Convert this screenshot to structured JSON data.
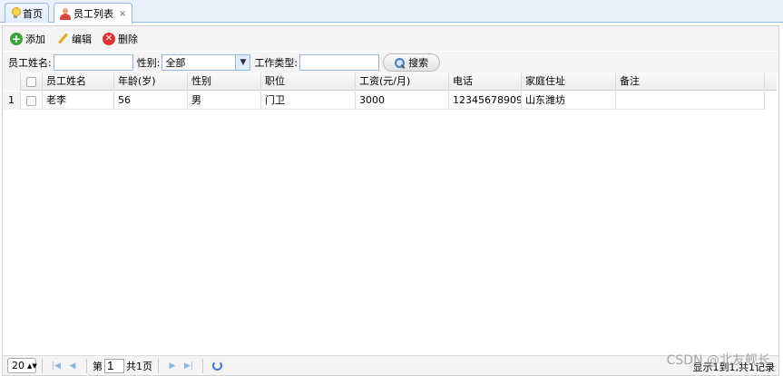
{
  "tabs": [
    {
      "label": "首页",
      "icon": "bulb-icon"
    },
    {
      "label": "员工列表",
      "icon": "user-icon",
      "close": "×"
    }
  ],
  "toolbar": {
    "add": "添加",
    "edit": "编辑",
    "delete": "删除"
  },
  "search": {
    "name_label": "员工姓名:",
    "name_value": "",
    "gender_label": "性别:",
    "gender_value": "全部",
    "type_label": "工作类型:",
    "type_value": "",
    "button": "搜索"
  },
  "grid": {
    "columns": [
      "员工姓名",
      "年龄(岁)",
      "性别",
      "职位",
      "工资(元/月)",
      "电话",
      "家庭住址",
      "备注"
    ],
    "rows": [
      {
        "num": "1",
        "cells": [
          "老李",
          "56",
          "男",
          "门卫",
          "3000",
          "12345678909",
          "山东潍坊",
          ""
        ]
      }
    ]
  },
  "pager": {
    "page_size": "20",
    "page_prefix": "第",
    "page_value": "1",
    "page_total": "共1页",
    "info": "显示1到1,共1记录"
  },
  "watermark": "CSDN @北友舰长"
}
